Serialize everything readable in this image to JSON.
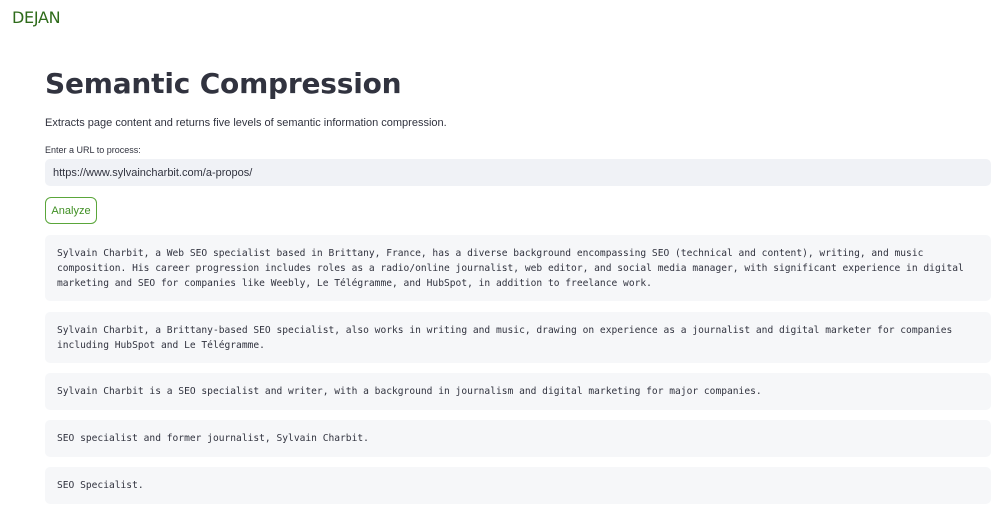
{
  "brand": {
    "logo_text": "DEJAN"
  },
  "page": {
    "title": "Semantic Compression",
    "subtitle": "Extracts page content and returns five levels of semantic information compression."
  },
  "form": {
    "url_label": "Enter a URL to process:",
    "url_value": "https://www.sylvaincharbit.com/a-propos/",
    "analyze_label": "Analyze"
  },
  "results": [
    "Sylvain Charbit, a Web SEO specialist based in Brittany, France, has a diverse background encompassing SEO (technical and content), writing, and music composition. His career progression includes roles as a radio/online journalist, web editor, and social media manager, with significant experience in digital marketing and SEO for companies like Weebly, Le Télégramme, and HubSpot, in addition to freelance work.",
    "Sylvain Charbit, a Brittany-based SEO specialist, also works in writing and music, drawing on experience as a journalist and digital marketer for companies including HubSpot and Le Télégramme.",
    "Sylvain Charbit is a SEO specialist and writer, with a background in journalism and digital marketing for major companies.",
    "SEO specialist and former journalist, Sylvain Charbit.",
    "SEO Specialist."
  ],
  "colors": {
    "brand_green": "#2e6b1a",
    "button_border": "#5aa63a",
    "input_bg": "#f0f2f6",
    "result_bg": "#f6f7f9"
  }
}
